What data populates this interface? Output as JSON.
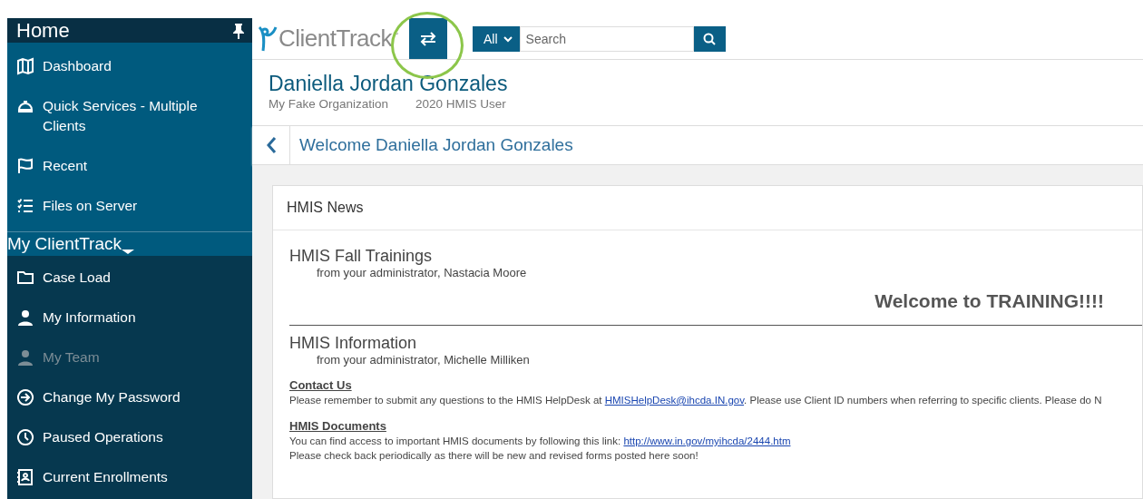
{
  "sidebar": {
    "title": "Home",
    "sections": [
      {
        "items": [
          {
            "label": "Dashboard",
            "disabled": false
          },
          {
            "label": "Quick Services - Multiple Clients",
            "disabled": false
          },
          {
            "label": "Recent",
            "disabled": false
          },
          {
            "label": "Files on Server",
            "disabled": false
          }
        ]
      },
      {
        "title": "My ClientTrack",
        "items": [
          {
            "label": "Case Load",
            "disabled": false
          },
          {
            "label": "My Information",
            "disabled": false
          },
          {
            "label": "My Team",
            "disabled": true
          },
          {
            "label": "Change My Password",
            "disabled": false
          },
          {
            "label": "Paused Operations",
            "disabled": false
          },
          {
            "label": "Current Enrollments",
            "disabled": false
          }
        ]
      }
    ]
  },
  "topbar": {
    "logo": "ClientTrack",
    "logo_mark": "™",
    "scope": "All",
    "search": {
      "placeholder": "Search"
    }
  },
  "user": {
    "name": "Daniella Jordan Gonzales",
    "organization": "My Fake Organization",
    "role": "2020 HMIS User"
  },
  "page_title": "Welcome Daniella Jordan Gonzales",
  "news": {
    "title": "HMIS News",
    "posts": [
      {
        "title": "HMIS Fall Trainings",
        "byline": "from your administrator, Nastacia Moore",
        "banner": "Welcome to TRAINING!!!!"
      },
      {
        "title": "HMIS Information",
        "byline": "from your administrator, Michelle Milliken",
        "blocks": [
          {
            "heading": "Contact Us",
            "lines": [
              {
                "before": "Please remember to submit any questions to the HMIS HelpDesk at ",
                "link": "HMISHelpDesk@ihcda.IN.gov",
                "after": ".  Please use Client ID numbers when referring to specific clients.  Please do N"
              }
            ]
          },
          {
            "heading": "HMIS Documents",
            "lines": [
              {
                "before": "You can find access to important HMIS documents by following this link:  ",
                "link": "http://www.in.gov/myihcda/2444.htm"
              },
              {
                "before": "Please check back periodically as there will be new and revised forms posted here soon!"
              }
            ]
          }
        ]
      }
    ]
  }
}
